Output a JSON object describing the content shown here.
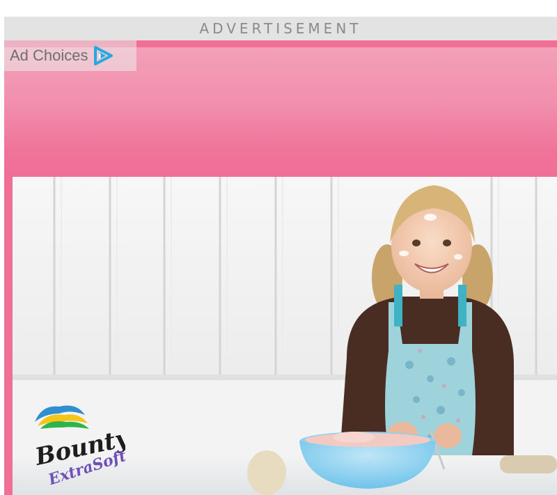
{
  "ad_banner": {
    "label": "ADVERTISEMENT"
  },
  "ad_choices": {
    "label": "Ad Choices",
    "icon": "ad-choices-triangle-icon"
  },
  "advertisement": {
    "brand": "Bounty",
    "sub_brand": "ExtraSoft",
    "image": "child-baking-photo",
    "colors": {
      "frame_pink": "#ef6f97",
      "header_pink_top": "#f3a0b7",
      "label_bar": "#e3e3e3",
      "ad_choices_blue": "#27a8e0"
    }
  }
}
